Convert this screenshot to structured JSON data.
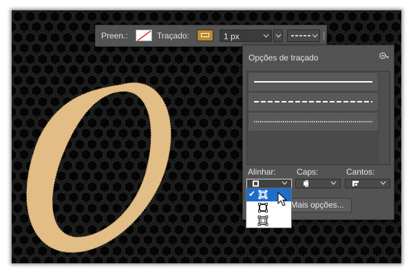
{
  "options_bar": {
    "fill_label": "Preen.:",
    "stroke_label": "Traçado:",
    "stroke_width": "1 px",
    "stroke_color": "#b98c2c"
  },
  "stroke_options": {
    "title": "Opções de traçado",
    "presets": [
      "solid-line",
      "dashed-line",
      "dotted-line"
    ],
    "align_label": "Alinhar:",
    "caps_label": "Caps:",
    "corners_label": "Cantos:",
    "more_options_label": "Mais opções..."
  },
  "align_menu": {
    "items": [
      "inside-align-icon",
      "center-align-icon",
      "outside-align-icon"
    ],
    "selected_index": 0
  },
  "canvas": {
    "shape_color": "#e2bd85",
    "background": "hexagon-mesh"
  }
}
